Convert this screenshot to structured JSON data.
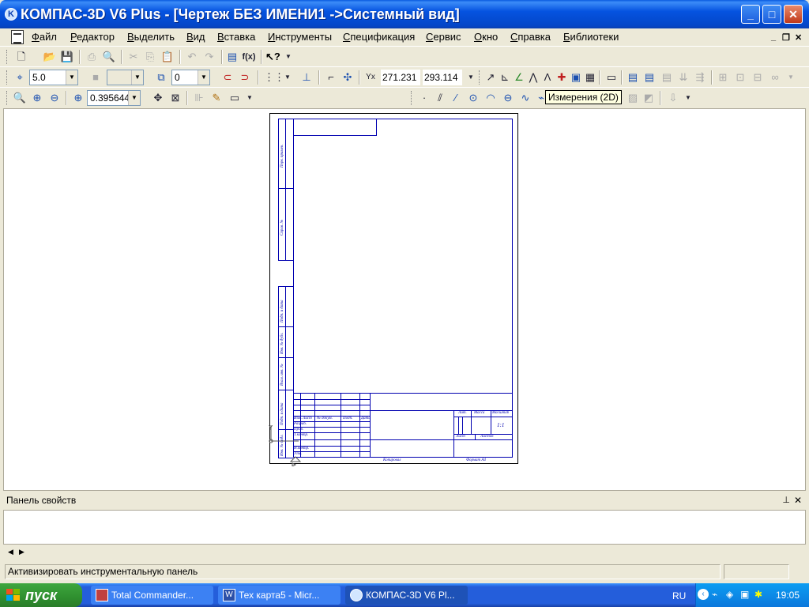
{
  "window": {
    "title": "КОМПАС-3D V6 Plus - [Чертеж БЕЗ ИМЕНИ1 ->Системный вид]"
  },
  "menu": [
    "Файл",
    "Редактор",
    "Выделить",
    "Вид",
    "Вставка",
    "Инструменты",
    "Спецификация",
    "Сервис",
    "Окно",
    "Справка",
    "Библиотеки"
  ],
  "toolbar": {
    "line_style_value": "5.0",
    "layer_value": "0",
    "coord_x": "271.231",
    "coord_y": "293.114",
    "zoom_value": "0.395644",
    "tooltip": "Измерения (2D)"
  },
  "drawing": {
    "side_labels": [
      "Перв. примен.",
      "Справ. №",
      "Подп. и дата",
      "Инв. № дубл.",
      "Взам. инв. №",
      "Подп. и дата",
      "Инв. № подл."
    ],
    "stamp_labels": [
      "Изм.",
      "Лист",
      "№ докум.",
      "Подп.",
      "Дата",
      "Разраб.",
      "Пров.",
      "Т.контр.",
      "Н.контр.",
      "Утв.",
      "Лит.",
      "Масса",
      "Масштаб",
      "Лист",
      "Листов",
      "1:1"
    ],
    "bottom_labels": [
      "Копировал",
      "Формат А4"
    ]
  },
  "properties_panel": {
    "title": "Панель свойств"
  },
  "status": {
    "text": "Активизировать инструментальную панель"
  },
  "taskbar": {
    "start_label": "пуск",
    "tasks": [
      "Total Commander...",
      "Тех карта5 - Micr...",
      "КОМПАС-3D V6 Pl..."
    ],
    "lang": "RU",
    "clock": "19:05"
  }
}
